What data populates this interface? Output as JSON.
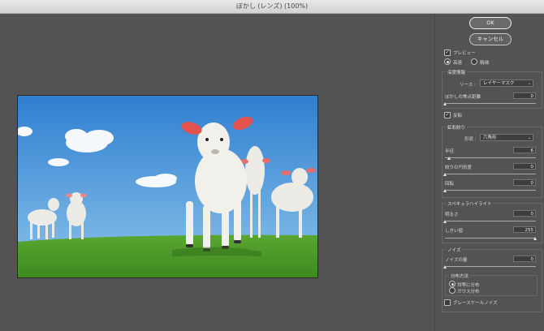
{
  "window": {
    "title": "ぼかし (レンズ) (100%)"
  },
  "buttons": {
    "ok": "OK",
    "cancel": "キャンセル"
  },
  "preview": {
    "label": "プレビュー",
    "checked": true,
    "mode_fast": "高速",
    "mode_accurate": "精細",
    "selected": "fast"
  },
  "depth_map": {
    "title": "深度情報",
    "source_label": "ソース :",
    "source_value": "レイヤーマスク",
    "focal_label": "ぼかしの焦点距離",
    "focal_value": "0",
    "invert_label": "反転",
    "invert_checked": true
  },
  "iris": {
    "title": "虹彩絞り",
    "shape_label": "形状 :",
    "shape_value": "六角形",
    "radius_label": "半径",
    "radius_value": "6",
    "curvature_label": "絞りの円形度",
    "curvature_value": "0",
    "rotation_label": "回転",
    "rotation_value": "0"
  },
  "specular": {
    "title": "スペキュラハイライト",
    "brightness_label": "明るさ",
    "brightness_value": "0",
    "threshold_label": "しきい値",
    "threshold_value": "255"
  },
  "noise": {
    "title": "ノイズ",
    "amount_label": "ノイズの量",
    "amount_value": "0",
    "distribution_title": "分布方法",
    "uniform_label": "均等に分布",
    "gaussian_label": "ガウス分布",
    "selected": "uniform",
    "monochrome_label": "グレースケールノイズ",
    "monochrome_checked": false
  },
  "colors": {
    "sky": "#3a8fd6",
    "grass": "#4a9a2a",
    "panel": "#535353"
  }
}
